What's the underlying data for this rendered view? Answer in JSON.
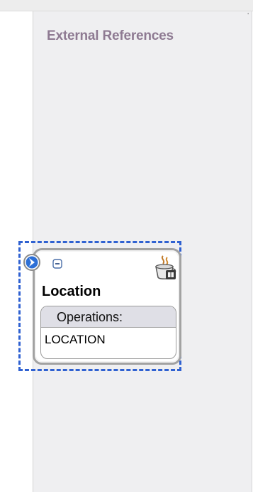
{
  "swimlane": {
    "title": "External References"
  },
  "component": {
    "name": "Location",
    "operations_header": "Operations:",
    "operations": [
      "LOCATION"
    ],
    "icons": {
      "port": "service-port-arrow-icon",
      "collapse": "collapse-icon",
      "implementation": "java-coffee-cup-icon"
    },
    "selected": true
  },
  "colors": {
    "title": "#8e7a92",
    "selection_border": "#2f61d1",
    "swimlane_bg": "#efeff1",
    "ops_header_bg": "#dfdfe6"
  }
}
